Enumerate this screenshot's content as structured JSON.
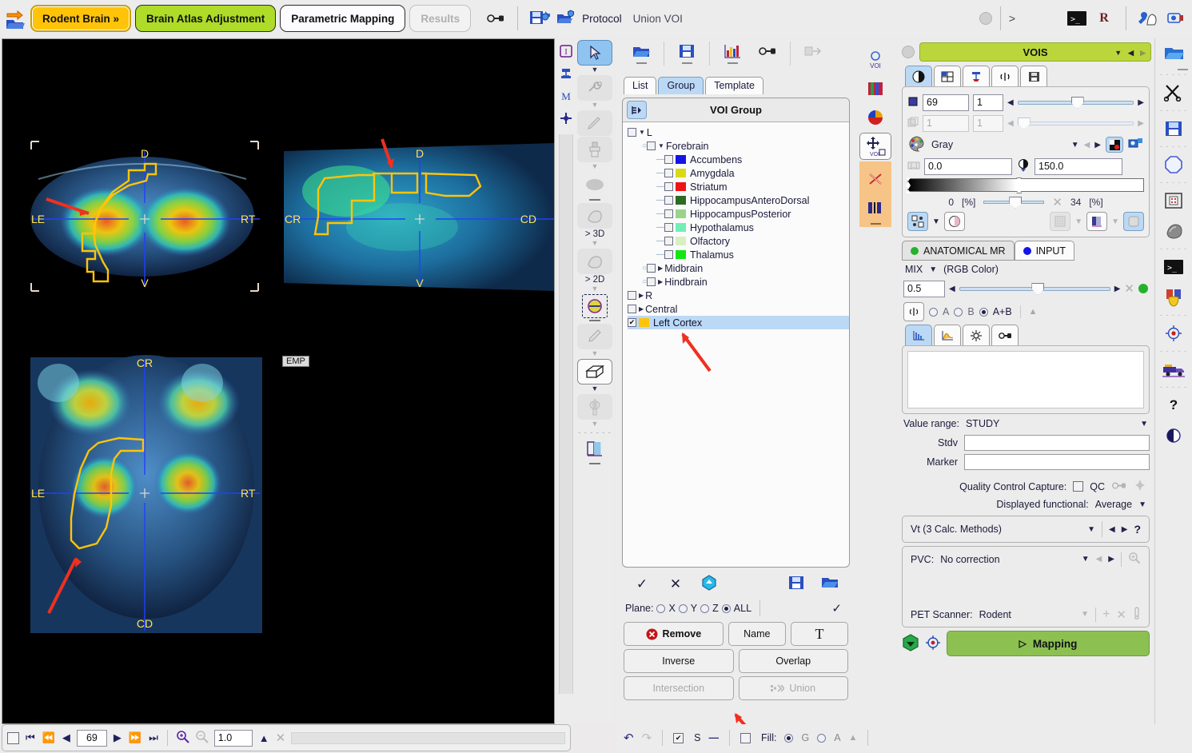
{
  "topbar": {
    "open_icon": "open-folder-arrow-icon",
    "steps": [
      {
        "label": "Rodent Brain »",
        "state": "selected"
      },
      {
        "label": "Brain Atlas Adjustment",
        "state": "green"
      },
      {
        "label": "Parametric Mapping",
        "state": "white"
      },
      {
        "label": "Results",
        "state": "disabled"
      }
    ],
    "link_icon": "chain-link-icon",
    "save_protocol_icon": "save-protocol-icon",
    "load_protocol_icon": "load-protocol-icon",
    "protocol_label": "Protocol",
    "document_label": "Union VOI",
    "gt_symbol": ">",
    "console_icon": "terminal-icon",
    "r_label": "R",
    "tools_icon": "tools-icon",
    "camera_icon": "camera-icon"
  },
  "viewer": {
    "slices": [
      {
        "name": "coronal",
        "labels": {
          "top": "D",
          "left": "LE",
          "right": "RT",
          "bottom": "V"
        }
      },
      {
        "name": "sagittal",
        "labels": {
          "top": "D",
          "left": "CR",
          "right": "CD",
          "bottom": "V"
        }
      },
      {
        "name": "transverse",
        "labels": {
          "top": "CR",
          "left": "LE",
          "right": "RT",
          "bottom": "CD"
        }
      }
    ],
    "emp_badge": "EMP",
    "bottom": {
      "slice_number": "69",
      "zoom_value": "1.0",
      "first_icon": "skip-to-first-icon",
      "fast_back_icon": "fast-rewind-icon",
      "prev_icon": "step-back-icon",
      "next_icon": "step-forward-icon",
      "fast_fwd_icon": "fast-forward-icon",
      "last_icon": "skip-to-last-icon",
      "zoom_in_icon": "zoom-in-icon",
      "zoom_out_icon": "zoom-out-icon",
      "up_icon": "triangle-up-icon",
      "close_icon": "close-x-icon"
    }
  },
  "vstrip": {
    "left_icons": [
      "info-icon",
      "layout-icon",
      "m-letter-icon",
      "crosshair-icon"
    ],
    "tools": [
      {
        "name": "arrow-select-tool",
        "state": "active",
        "caret": true
      },
      {
        "name": "wrench-tool",
        "state": "dim",
        "caret": true
      },
      {
        "name": "pen-tool",
        "state": "dim",
        "caret": false
      },
      {
        "name": "brush-tool",
        "state": "dim",
        "caret": true
      },
      {
        "name": "ellipse-tool",
        "state": "plain",
        "caret": false
      },
      {
        "name": "region-3d-tool",
        "state": "dim",
        "label": "> 3D",
        "caret": true
      },
      {
        "name": "region-2d-tool",
        "state": "dim",
        "label": "> 2D",
        "caret": true
      },
      {
        "name": "threshold-tool",
        "state": "plain",
        "caret": false
      },
      {
        "name": "eraser-tool",
        "state": "dim",
        "caret": true
      },
      {
        "name": "cube-tool",
        "state": "sel",
        "caret": true
      },
      {
        "name": "mirror-tool",
        "state": "dim",
        "caret": true
      },
      {
        "name": "colorbar-tool",
        "state": "plain",
        "caret": false
      }
    ]
  },
  "voi_panel": {
    "toolbar": [
      {
        "name": "open-voi-icon"
      },
      {
        "name": "save-voi-icon"
      },
      {
        "name": "statistics-icon"
      },
      {
        "name": "link-icon"
      },
      {
        "name": "transform-icon",
        "dim": true
      }
    ],
    "tabs": [
      {
        "label": "List",
        "active": false
      },
      {
        "label": "Group",
        "active": true
      },
      {
        "label": "Template",
        "active": false
      }
    ],
    "group_header": "VOI Group",
    "tree": [
      {
        "depth": 0,
        "label": "L",
        "checked": false,
        "expanded": true,
        "color": null
      },
      {
        "depth": 1,
        "label": "Forebrain",
        "checked": false,
        "expanded": true,
        "color": null
      },
      {
        "depth": 2,
        "label": "Accumbens",
        "checked": false,
        "color": "#1414e6"
      },
      {
        "depth": 2,
        "label": "Amygdala",
        "checked": false,
        "color": "#dada14"
      },
      {
        "depth": 2,
        "label": "Striatum",
        "checked": false,
        "color": "#ee1414"
      },
      {
        "depth": 2,
        "label": "HippocampusAnteroDorsal",
        "checked": false,
        "color": "#2c6b22"
      },
      {
        "depth": 2,
        "label": "HippocampusPosterior",
        "checked": false,
        "color": "#9ad48a"
      },
      {
        "depth": 2,
        "label": "Hypothalamus",
        "checked": false,
        "color": "#72eeb6"
      },
      {
        "depth": 2,
        "label": "Olfactory",
        "checked": false,
        "color": "#d8f0c0"
      },
      {
        "depth": 2,
        "label": "Thalamus",
        "checked": false,
        "color": "#14e614"
      },
      {
        "depth": 1,
        "label": "Midbrain",
        "checked": false,
        "collapsed": true,
        "color": null
      },
      {
        "depth": 1,
        "label": "Hindbrain",
        "checked": false,
        "collapsed": true,
        "color": null
      },
      {
        "depth": 0,
        "label": "R",
        "checked": false,
        "collapsed": true,
        "color": null
      },
      {
        "depth": 0,
        "label": "Central",
        "checked": false,
        "collapsed": true,
        "color": null
      },
      {
        "depth": 0,
        "label": "Left Cortex",
        "checked": true,
        "selected": true,
        "color": "#FFC40A"
      }
    ],
    "footer_icons": [
      "confirm-check-icon",
      "cancel-x-icon",
      "upload-icon",
      "save-icon",
      "open-icon"
    ],
    "plane_label": "Plane:",
    "plane_options": [
      {
        "label": "X",
        "selected": false
      },
      {
        "label": "Y",
        "selected": false
      },
      {
        "label": "Z",
        "selected": false
      },
      {
        "label": "ALL",
        "selected": true
      }
    ],
    "plane_check_icon": "check-icon",
    "buttons": [
      {
        "label": "Remove",
        "icon": "remove-circle-icon",
        "disabled": false
      },
      {
        "label": "Name",
        "disabled": false
      },
      {
        "label": "T",
        "icon": "text-icon",
        "disabled": false
      },
      {
        "label": "Inverse",
        "disabled": false
      },
      {
        "label": "Overlap",
        "disabled": false
      },
      {
        "label": "Intersection",
        "disabled": true
      },
      {
        "label": "Union",
        "icon": "union-icon",
        "disabled": true
      }
    ],
    "bottombar": {
      "undo_icon": "undo-icon",
      "redo_icon": "redo-icon",
      "s_checkbox": {
        "label": "S",
        "checked": true
      },
      "minus_icon": "minus-icon",
      "fill_checkbox": {
        "label": "Fill:",
        "checked": false
      },
      "fill_options": [
        {
          "label": "G",
          "selected": true
        },
        {
          "label": "A",
          "selected": false
        }
      ],
      "up_icon": "triangle-up-icon"
    }
  },
  "voi_side_icons": [
    {
      "name": "voi-outline-icon",
      "label": "VOI"
    },
    {
      "name": "colorbar-icon"
    },
    {
      "name": "palette-sphere-icon"
    },
    {
      "name": "move-voi-icon",
      "label": "VOI",
      "selected": true
    },
    {
      "name": "delete-x-icon",
      "highlight": true
    },
    {
      "name": "split-icon",
      "highlight": true
    }
  ],
  "right_panel": {
    "title": "VOIS",
    "title_icons": [
      "chevron-down-icon",
      "prev-arrow-icon",
      "next-arrow-icon"
    ],
    "collapse_icon": "collapse-circle-icon",
    "subtabs": [
      {
        "name": "contrast-tab",
        "active": true
      },
      {
        "name": "layout-tab",
        "active": false
      },
      {
        "name": "lamp-tab",
        "active": false
      },
      {
        "name": "radial-tab",
        "active": false
      },
      {
        "name": "save-tab",
        "active": false
      }
    ],
    "slice_row": {
      "icon": "slice-icon",
      "value": "69",
      "increment": "1"
    },
    "frame_row": {
      "icon": "frame-icon",
      "value": "1",
      "increment": "1",
      "disabled": true
    },
    "palette": {
      "icon": "palette-icon",
      "name": "Gray",
      "invert_icon": "invert-icon",
      "copy_icon": "copy-color-icon"
    },
    "window": {
      "min": "0.0",
      "max": "150.0",
      "min_icon": "min-icon",
      "max_icon": "contrast-icon"
    },
    "percent": {
      "low": "0",
      "low_unit": "[%]",
      "high": "34",
      "high_unit": "[%]",
      "x_icon": "clear-x-icon"
    },
    "tool_icons": [
      {
        "name": "marker-grid-icon",
        "active": true
      },
      {
        "name": "chevron-down-icon"
      },
      {
        "name": "half-shade-icon"
      },
      {
        "name": "grid-icon",
        "dim": true
      },
      {
        "name": "chevron-down-icon-2",
        "dim": true
      },
      {
        "name": "mesh-icon"
      },
      {
        "name": "chevron-down-icon-3",
        "dim": true
      },
      {
        "name": "rounded-square-icon",
        "active": true
      }
    ],
    "ab_tabs": [
      {
        "label": "ANATOMICAL MR",
        "color": "#25b22b",
        "active": true
      },
      {
        "label": "INPUT",
        "color": "#1414e6",
        "active": false
      }
    ],
    "mix": {
      "label": "MIX",
      "mode": "(RGB Color)"
    },
    "alpha": {
      "value": "0.5",
      "dot_color": "#25b22b",
      "x_icon": "clear-x-icon"
    },
    "ab_radios": {
      "icon": "radial-icon",
      "options": [
        {
          "label": "A",
          "selected": false
        },
        {
          "label": "B",
          "selected": false
        },
        {
          "label": "A+B",
          "selected": true
        }
      ],
      "up_icon": "triangle-up-icon"
    },
    "stat_tabs": [
      {
        "name": "histogram-tab",
        "active": true
      },
      {
        "name": "curve-tab",
        "active": false
      },
      {
        "name": "settings-tab",
        "active": false
      },
      {
        "name": "link-tab",
        "active": false
      }
    ],
    "value_range": {
      "label": "Value range:",
      "value": "STUDY"
    },
    "stdv": {
      "label": "Stdv",
      "value": ""
    },
    "marker": {
      "label": "Marker",
      "value": ""
    },
    "qc": {
      "label": "Quality Control Capture:",
      "checkbox_label": "QC",
      "checked": false,
      "link_icon": "link-icon",
      "pin_icon": "pin-icon"
    },
    "displayed_functional": {
      "label": "Displayed functional:",
      "value": "Average"
    },
    "method": {
      "value": "Vt (3 Calc. Methods)",
      "help": "?"
    },
    "pvc": {
      "label": "PVC:",
      "value": "No correction",
      "zoom_icon": "magnify-icon"
    },
    "pet_scanner": {
      "label": "PET Scanner:",
      "value": "Rodent",
      "add_icon": "plus-icon",
      "del_icon": "x-icon",
      "config_icon": "config-icon"
    },
    "footer": {
      "down_icon": "download-green-icon",
      "target_icon": "target-icon",
      "map_button": "Mapping",
      "map_icon": "play-triangle-icon"
    }
  },
  "rail_icons": [
    "open-folder-icon",
    "cut-scissors-icon",
    "save-disk-icon",
    "octagon-icon",
    "matrix-icon",
    "stone-icon",
    "terminal-icon",
    "shield-icon",
    "target-icon",
    "truck-icon",
    "help-question-icon",
    "contrast-moon-icon"
  ]
}
